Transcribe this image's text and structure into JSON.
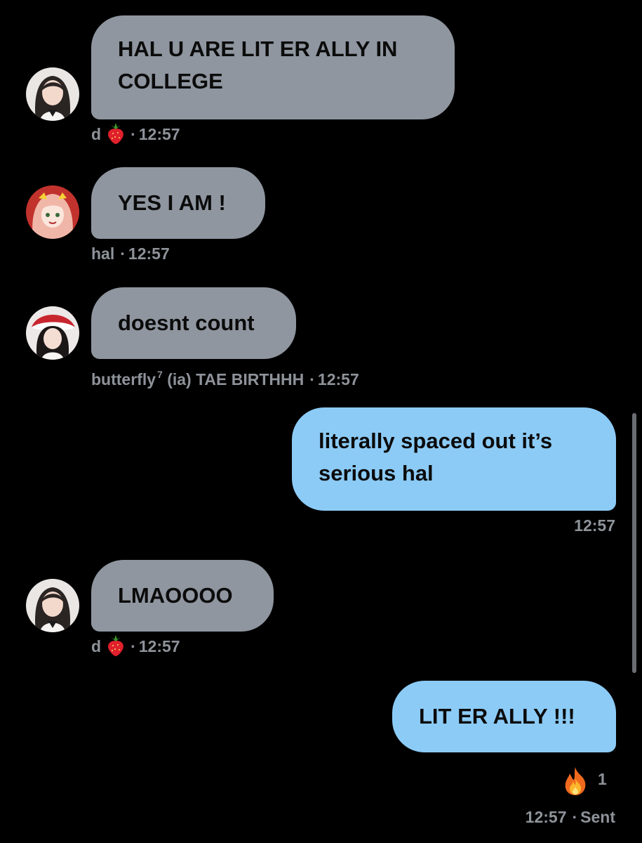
{
  "messages": [
    {
      "sender": "d",
      "sender_emoji": "strawberry",
      "direction": "incoming",
      "text": "HAL U ARE LIT ER ALLY IN COLLEGE",
      "text_lines": [
        "HAL U ARE LIT ER ALLY IN",
        "COLLEGE"
      ],
      "time": "12:57"
    },
    {
      "sender": "hal",
      "direction": "incoming",
      "text": "YES I AM !",
      "time": "12:57"
    },
    {
      "sender": "butterfly",
      "sender_sup": "7",
      "sender_suffix": "(ia) TAE BIRTHHH",
      "direction": "incoming",
      "text": "doesnt count",
      "time": "12:57"
    },
    {
      "direction": "outgoing",
      "text": "literally spaced out it’s serious hal",
      "text_lines": [
        "literally spaced out it’s",
        "serious hal"
      ],
      "time": "12:57"
    },
    {
      "sender": "d",
      "sender_emoji": "strawberry",
      "direction": "incoming",
      "text": "LMAOOOO",
      "time": "12:57"
    },
    {
      "direction": "outgoing",
      "text": "LIT ER ALLY !!!",
      "time": "12:57",
      "status": "Sent",
      "reaction": {
        "emoji": "fire",
        "count": "1"
      }
    }
  ],
  "separator": "·",
  "colors": {
    "background": "#000000",
    "incoming_bubble": "#8f96a0",
    "outgoing_bubble": "#8ccbf6",
    "meta_text": "#8e939a"
  }
}
